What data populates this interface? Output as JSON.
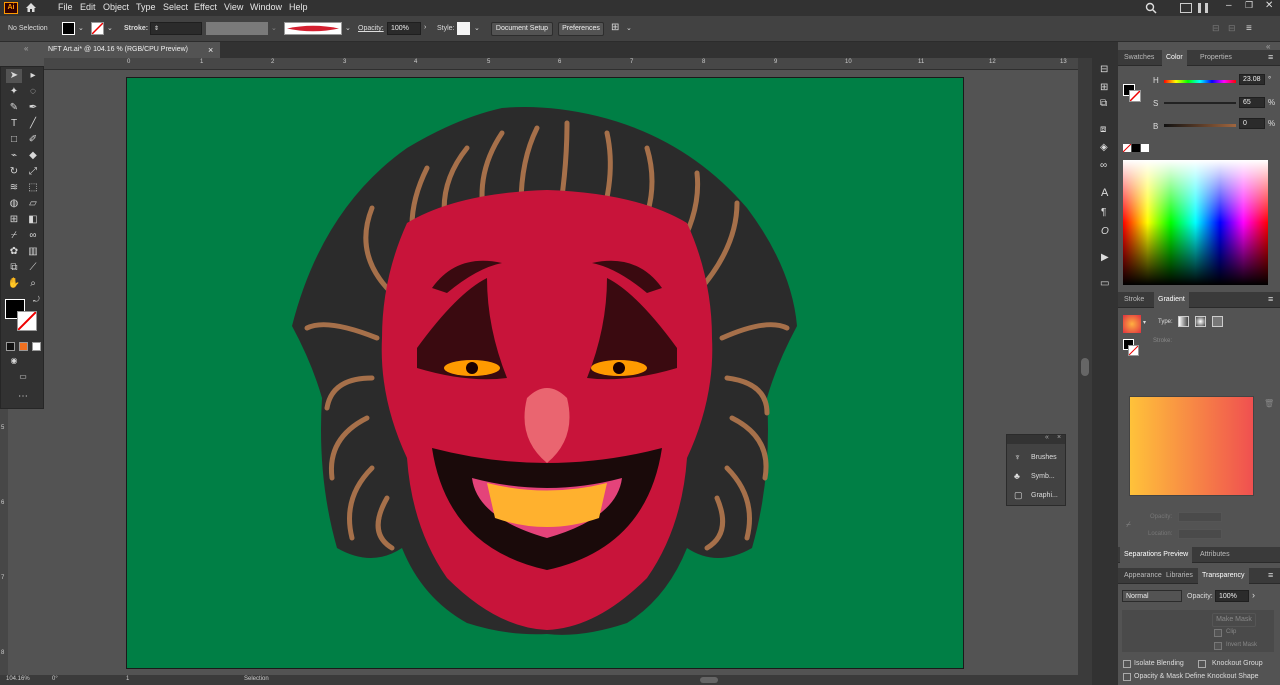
{
  "app": {
    "logo": "Ai"
  },
  "menu": [
    "File",
    "Edit",
    "Object",
    "Type",
    "Select",
    "Effect",
    "View",
    "Window",
    "Help"
  ],
  "control": {
    "selection": "No Selection",
    "stroke_label": "Stroke:",
    "opacity_label": "Opacity:",
    "opacity_value": "100%",
    "style_label": "Style:",
    "document_setup": "Document Setup",
    "preferences": "Preferences"
  },
  "document": {
    "tab_title": "NFT Art.ai* @ 104.16 % (RGB/CPU Preview)",
    "close": "×"
  },
  "ruler": {
    "top": [
      "0",
      "1",
      "2",
      "3",
      "4",
      "5",
      "6",
      "7",
      "8",
      "9",
      "10",
      "11",
      "12",
      "13"
    ],
    "left": [
      "5",
      "6",
      "7",
      "8"
    ]
  },
  "status": {
    "zoom": "104.16%",
    "rotate": "0°",
    "artboard": "1",
    "tool": "Selection"
  },
  "panels": {
    "color_tabs": [
      "Swatches",
      "Color",
      "Properties"
    ],
    "hsb": [
      {
        "label": "H",
        "value": "23.08",
        "unit": "°"
      },
      {
        "label": "S",
        "value": "65",
        "unit": "%"
      },
      {
        "label": "B",
        "value": "0",
        "unit": "%"
      }
    ],
    "gradient_tabs": [
      "Stroke",
      "Gradient"
    ],
    "gradient": {
      "type_label": "Type:",
      "stroke_label": "Stroke:",
      "opacity_label": "Opacity:",
      "location_label": "Location:"
    },
    "separation_tabs": [
      "Separations Preview",
      "Attributes"
    ],
    "transparency_tabs": [
      "Appearance",
      "Libraries",
      "Transparency"
    ],
    "transparency": {
      "mode": "Normal",
      "opacity_label": "Opacity:",
      "opacity_value": "100%",
      "make_mask": "Make Mask",
      "clip": "Clip",
      "invert_mask": "Invert Mask",
      "isolate": "Isolate Blending",
      "knockout": "Knockout Group",
      "opacity_mask": "Opacity & Mask Define Knockout Shape"
    },
    "float_items": [
      "Brushes",
      "Symb...",
      "Graphi..."
    ]
  },
  "colors": {
    "artboard": "#007f45",
    "face": "#c8143a",
    "hair_dark": "#2b2b2b",
    "hair_light": "#a6704a",
    "brand": "#ff9a00"
  },
  "icons": [
    "home-icon",
    "search-icon",
    "arrange-icon",
    "selection-tool-icon",
    "direct-selection-tool-icon",
    "pen-tool-icon",
    "type-tool-icon",
    "rectangle-tool-icon",
    "brush-tool-icon",
    "hand-tool-icon",
    "zoom-tool-icon",
    "eyedropper-tool-icon",
    "rotate-tool-icon",
    "scale-tool-icon",
    "gradient-tool-icon",
    "mesh-tool-icon",
    "symbol-sprayer-icon",
    "graph-tool-icon",
    "artboard-tool-icon",
    "slice-tool-icon",
    "more-tools-icon"
  ]
}
